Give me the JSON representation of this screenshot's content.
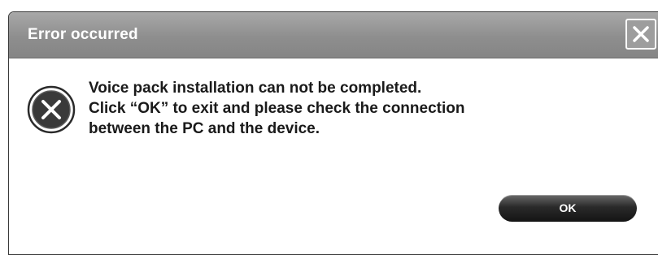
{
  "dialog": {
    "title": "Error occurred",
    "close_icon": "close-icon",
    "error_icon": "error-x-circle-icon",
    "message_lines": [
      "Voice pack installation can not be completed.",
      "Click “OK” to exit and please check the connection",
      "between the PC and the device."
    ],
    "ok_label": "OK"
  },
  "colors": {
    "titlebar": "#8e8e8e",
    "title_text": "#ffffff",
    "message_text": "#1a1a1a",
    "button": "#1e1e1e"
  }
}
